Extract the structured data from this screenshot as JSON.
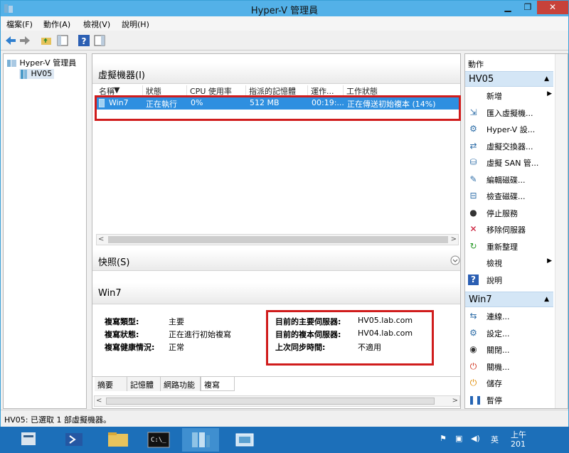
{
  "window": {
    "title": "Hyper-V 管理員"
  },
  "menu": [
    "檔案(F)",
    "動作(A)",
    "檢視(V)",
    "說明(H)"
  ],
  "tree": {
    "root": "Hyper-V 管理員",
    "server": "HV05"
  },
  "vm_panel": {
    "title": "虛擬機器(I)",
    "columns": [
      "名稱",
      "狀態",
      "CPU 使用率",
      "指派的記憶體",
      "運作...",
      "工作狀態"
    ],
    "rows": [
      {
        "name": "Win7",
        "state": "正在執行",
        "cpu": "0%",
        "memory": "512 MB",
        "uptime": "00:19:...",
        "status": "正在傳送初始複本 (14%)"
      }
    ]
  },
  "snapshots": {
    "title": "快照(S)"
  },
  "detail": {
    "title": "Win7",
    "left": [
      {
        "label": "複寫類型:",
        "value": "主要"
      },
      {
        "label": "複寫狀態:",
        "value": "正在進行初始複寫"
      },
      {
        "label": "複寫健康情況:",
        "value": "正常"
      }
    ],
    "right": [
      {
        "label": "目前的主要伺服器:",
        "value": "HV05.lab.com"
      },
      {
        "label": "目前的複本伺服器:",
        "value": "HV04.lab.com"
      },
      {
        "label": "上次同步時間:",
        "value": "不適用"
      }
    ],
    "tabs": [
      "摘要",
      "記憶體",
      "網路功能",
      "複寫"
    ],
    "active_tab": "複寫"
  },
  "actions": {
    "title": "動作",
    "group1": "HV05",
    "items1": [
      {
        "label": "新增",
        "icon": "blank",
        "submenu": true
      },
      {
        "label": "匯入虛擬機...",
        "icon": "import-icon"
      },
      {
        "label": "Hyper-V 設...",
        "icon": "settings-icon"
      },
      {
        "label": "虛擬交換器...",
        "icon": "switch-icon"
      },
      {
        "label": "虛擬 SAN 管...",
        "icon": "san-icon"
      },
      {
        "label": "編輯磁碟...",
        "icon": "edit-disk-icon"
      },
      {
        "label": "檢查磁碟...",
        "icon": "inspect-disk-icon"
      },
      {
        "label": "停止服務",
        "icon": "stop-icon"
      },
      {
        "label": "移除伺服器",
        "icon": "remove-icon"
      },
      {
        "label": "重新整理",
        "icon": "refresh-icon"
      },
      {
        "label": "檢視",
        "icon": "blank",
        "submenu": true
      },
      {
        "label": "說明",
        "icon": "help-icon"
      }
    ],
    "group2": "Win7",
    "items2": [
      {
        "label": "連線...",
        "icon": "connect-icon"
      },
      {
        "label": "設定...",
        "icon": "settings-icon"
      },
      {
        "label": "關閉...",
        "icon": "turn-off-icon"
      },
      {
        "label": "關機...",
        "icon": "shutdown-icon"
      },
      {
        "label": "儲存",
        "icon": "save-icon"
      },
      {
        "label": "暫停",
        "icon": "pause-icon"
      }
    ]
  },
  "status": "HV05: 已選取 1 部虛擬機器。",
  "taskbar": {
    "lang": "英",
    "clock": "上午",
    "date": "201"
  },
  "colors": {
    "selection": "#2e8fe0",
    "highlight_box": "#d01c1c",
    "titlebar": "#53b1e8",
    "taskbar": "#1c6fb9"
  }
}
